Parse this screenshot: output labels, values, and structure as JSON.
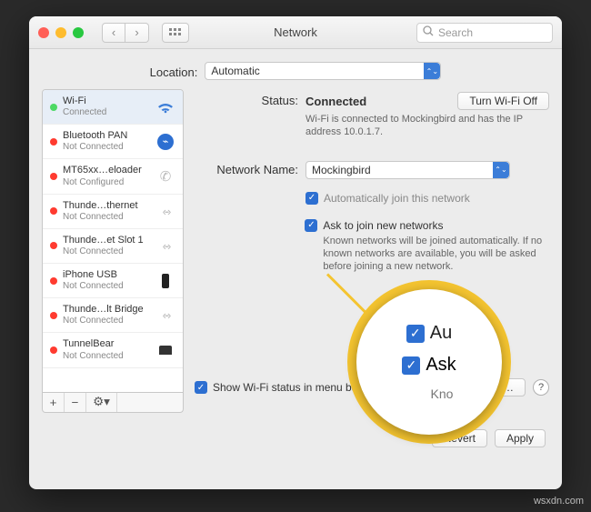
{
  "colors": {
    "red": "#ff5f57",
    "yellow": "#febc2e",
    "green": "#28c840",
    "status_green": "#4cd964",
    "status_red": "#ff3b30",
    "accent": "#2d6fd1",
    "highlight_ring": "#f4c430"
  },
  "titlebar": {
    "title": "Network",
    "search_placeholder": "Search"
  },
  "location": {
    "label": "Location:",
    "value": "Automatic"
  },
  "sidebar": {
    "items": [
      {
        "name": "Wi-Fi",
        "sub": "Connected",
        "dot": "#4cd964",
        "icon": "wifi"
      },
      {
        "name": "Bluetooth PAN",
        "sub": "Not Connected",
        "dot": "#ff3b30",
        "icon": "bluetooth"
      },
      {
        "name": "MT65xx…eloader",
        "sub": "Not Configured",
        "dot": "#ff3b30",
        "icon": "phone-sync"
      },
      {
        "name": "Thunde…thernet",
        "sub": "Not Connected",
        "dot": "#ff3b30",
        "icon": "arrows"
      },
      {
        "name": "Thunde…et Slot 1",
        "sub": "Not Connected",
        "dot": "#ff3b30",
        "icon": "arrows"
      },
      {
        "name": "iPhone USB",
        "sub": "Not Connected",
        "dot": "#ff3b30",
        "icon": "phone"
      },
      {
        "name": "Thunde…lt Bridge",
        "sub": "Not Connected",
        "dot": "#ff3b30",
        "icon": "arrows"
      },
      {
        "name": "TunnelBear",
        "sub": "Not Connected",
        "dot": "#ff3b30",
        "icon": "bear"
      }
    ],
    "footer_buttons": {
      "add": "+",
      "remove": "−",
      "gear": "⚙︎▾"
    }
  },
  "main": {
    "status_label": "Status:",
    "status_value": "Connected",
    "turn_off": "Turn Wi-Fi Off",
    "status_desc": "Wi-Fi is connected to Mockingbird and has the IP address 10.0.1.7.",
    "network_name_label": "Network Name:",
    "network_name_value": "Mockingbird",
    "auto_join": {
      "checked": true,
      "label": "Automatically join this network"
    },
    "ask_join": {
      "checked": true,
      "label": "Ask to join new networks",
      "desc": "Known networks will be joined automatically. If no known networks are available, you will be asked before joining a new network."
    },
    "show_status": {
      "checked": true,
      "label": "Show Wi-Fi status in menu bar"
    },
    "advanced": "Advanced…",
    "revert": "Revert",
    "apply": "Apply"
  },
  "callout": {
    "line1_checked": true,
    "line1_text": "Au",
    "line2_checked": true,
    "line2_text": "Ask",
    "line3_text": "Kno"
  },
  "watermark": "wsxdn.com"
}
